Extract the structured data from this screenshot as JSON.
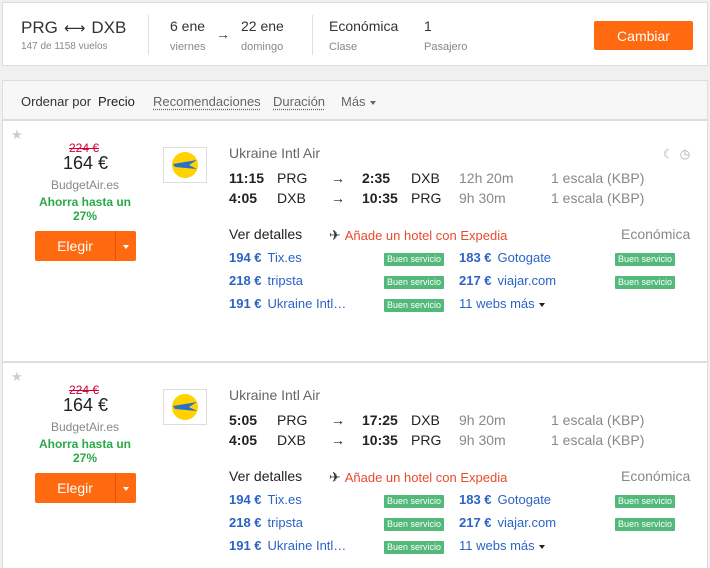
{
  "summary": {
    "origin": "PRG",
    "destination": "DXB",
    "flights_count": "147 de 1158 vuelos",
    "depart_date": "6 ene",
    "depart_day": "viernes",
    "return_date": "22 ene",
    "return_day": "domingo",
    "cabin": "Económica",
    "cabin_label": "Clase",
    "passengers": "1",
    "passengers_label": "Pasajero",
    "change_label": "Cambiar"
  },
  "sort": {
    "label": "Ordenar por",
    "active": "Precio",
    "options": [
      "Recomendaciones",
      "Duración"
    ],
    "more": "Más"
  },
  "results": [
    {
      "old_price": "224 €",
      "price": "164 €",
      "provider": "BudgetAir.es",
      "deal": "Ahorra hasta un 27%",
      "choose_label": "Elegir",
      "airline": "Ukraine Intl Air",
      "legs": [
        {
          "dep_time": "11:15",
          "dep_airport": "PRG",
          "arr_time": "2:35",
          "arr_airport": "DXB",
          "duration": "12h 20m",
          "stops": "1 escala (KBP)"
        },
        {
          "dep_time": "4:05",
          "dep_airport": "DXB",
          "arr_time": "10:35",
          "arr_airport": "PRG",
          "duration": "9h 30m",
          "stops": "1 escala (KBP)"
        }
      ],
      "details_label": "Ver detalles",
      "hotel_label": "Añade un hotel con Expedia",
      "cabin": "Económica",
      "offers_left": [
        {
          "price": "194 €",
          "site": "Tix.es",
          "badge": "Buen servicio"
        },
        {
          "price": "218 €",
          "site": "tripsta",
          "badge": "Buen servicio"
        },
        {
          "price": "191 €",
          "site": "Ukraine Intl…",
          "badge": "Buen servicio"
        }
      ],
      "offers_right": [
        {
          "price": "183 €",
          "site": "Gotogate",
          "badge": "Buen servicio"
        },
        {
          "price": "217 €",
          "site": "viajar.com",
          "badge": "Buen servicio"
        }
      ],
      "more_webs": "11 webs más"
    },
    {
      "old_price": "224 €",
      "price": "164 €",
      "provider": "BudgetAir.es",
      "deal": "Ahorra hasta un 27%",
      "choose_label": "Elegir",
      "airline": "Ukraine Intl Air",
      "legs": [
        {
          "dep_time": "5:05",
          "dep_airport": "PRG",
          "arr_time": "17:25",
          "arr_airport": "DXB",
          "duration": "9h 20m",
          "stops": "1 escala (KBP)"
        },
        {
          "dep_time": "4:05",
          "dep_airport": "DXB",
          "arr_time": "10:35",
          "arr_airport": "PRG",
          "duration": "9h 30m",
          "stops": "1 escala (KBP)"
        }
      ],
      "details_label": "Ver detalles",
      "hotel_label": "Añade un hotel con Expedia",
      "cabin": "Económica",
      "offers_left": [
        {
          "price": "194 €",
          "site": "Tix.es",
          "badge": "Buen servicio"
        },
        {
          "price": "218 €",
          "site": "tripsta",
          "badge": "Buen servicio"
        },
        {
          "price": "191 €",
          "site": "Ukraine Intl…",
          "badge": "Buen servicio"
        }
      ],
      "offers_right": [
        {
          "price": "183 €",
          "site": "Gotogate",
          "badge": "Buen servicio"
        },
        {
          "price": "217 €",
          "site": "viajar.com",
          "badge": "Buen servicio"
        }
      ],
      "more_webs": "11 webs más"
    }
  ],
  "colors": {
    "accent": "#ff690f",
    "link": "#2b63c5",
    "badge": "#52b97b",
    "deal": "#2aa84a",
    "hotel": "#e84a2e"
  }
}
